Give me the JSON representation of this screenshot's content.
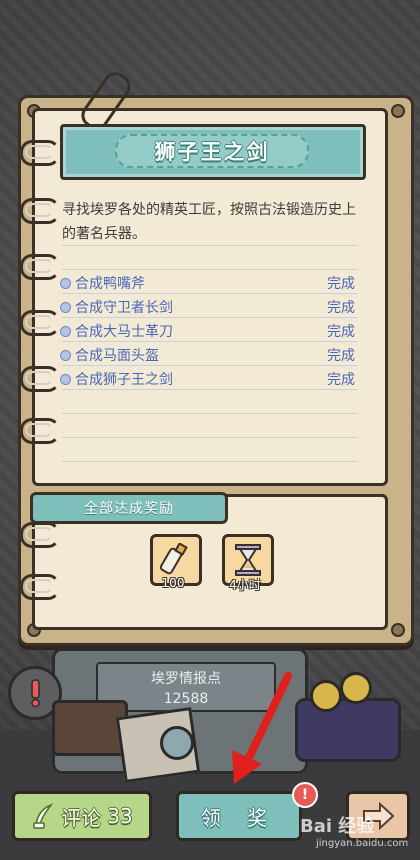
{
  "quest": {
    "title": "狮子王之剑",
    "description": "寻找埃罗各处的精英工匠，按照古法锻造历史上的著名兵器。",
    "tasks": [
      {
        "name": "合成鸭嘴斧",
        "status": "完成"
      },
      {
        "name": "合成守卫者长剑",
        "status": "完成"
      },
      {
        "name": "合成大马士革刀",
        "status": "完成"
      },
      {
        "name": "合成马面头盔",
        "status": "完成"
      },
      {
        "name": "合成狮子王之剑",
        "status": "完成"
      }
    ]
  },
  "rewards": {
    "label": "全部达成奖励",
    "items": [
      {
        "icon": "glue-tube-icon",
        "count": "100"
      },
      {
        "icon": "hourglass-icon",
        "count": "4小时"
      }
    ]
  },
  "info": {
    "title": "埃罗情报点",
    "value": "12588"
  },
  "buttons": {
    "comment_label": "评论",
    "comment_count": "33",
    "claim_label": "领 奖",
    "badge": "!"
  },
  "watermark": {
    "text": "Bai 经验",
    "sub": "jingyan.baidu.com"
  },
  "colors": {
    "teal": "#7fbfbb",
    "paper": "#f3ead6",
    "task_blue": "#4a66b8",
    "green_button": "#b6d68a",
    "alert_red": "#e85a58"
  }
}
